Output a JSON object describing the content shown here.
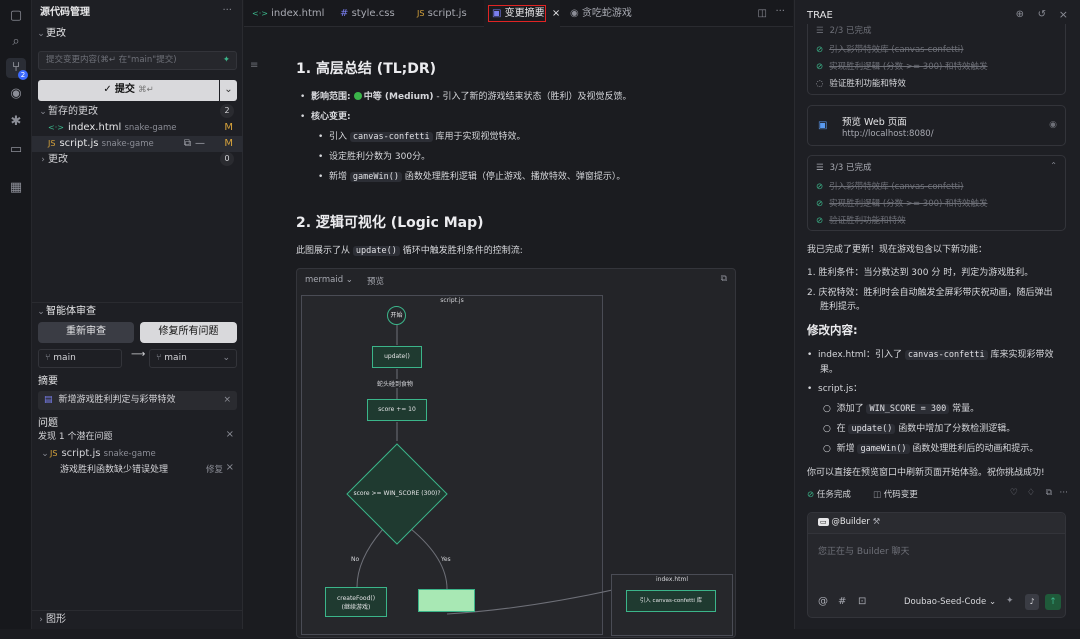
{
  "activity": {
    "scm_badge": "2"
  },
  "scm": {
    "title": "源代码管理",
    "more": "···",
    "changes_section": "更改",
    "commit_placeholder": "提交变更内容(⌘↵ 在\"main\"提交)",
    "commit_label": "提交",
    "commit_shortcut": "⌘↵",
    "staged_label": "暂存的更改",
    "staged_count": "2",
    "staged_files": [
      {
        "icon": "<·>",
        "name": "index.html",
        "folder": "snake-game",
        "status": "M"
      },
      {
        "icon": "JS",
        "name": "script.js",
        "folder": "snake-game",
        "status": "M"
      }
    ],
    "changes_label": "更改",
    "changes_count": "0",
    "agent_review_title": "智能体审查",
    "rereview_label": "重新审查",
    "fix_all_label": "修复所有问题",
    "branch_from": "main",
    "branch_to": "main",
    "summary_label": "摘要",
    "summary_text": "新增游戏胜利判定与彩带特效",
    "issues_label": "问题",
    "issues_found": "发现 1 个潜在问题",
    "issue_file": "script.js",
    "issue_folder": "snake-game",
    "issue_text": "游戏胜利函数缺少错误处理",
    "issue_fix": "修复",
    "graph_label": "图形"
  },
  "tabs": [
    {
      "icon": "<·>",
      "label": "index.html"
    },
    {
      "icon": "#",
      "label": "style.css"
    },
    {
      "icon": "JS",
      "label": "script.js"
    },
    {
      "icon": "▣",
      "label": "变更摘要"
    },
    {
      "icon": "◉",
      "label": "贪吃蛇游戏"
    }
  ],
  "doc": {
    "h1": "1. 高层总结 (TL;DR)",
    "impact_prefix": "影响范围: ",
    "impact_level": "中等 (Medium)",
    "impact_rest": " - 引入了新的游戏结束状态（胜利）及视觉反馈。",
    "core_label": "核心变更:",
    "sub1_a": "引入 ",
    "sub1_code": "canvas-confetti",
    "sub1_b": " 库用于实现视觉特效。",
    "sub2": "设定胜利分数为 300分。",
    "sub3_a": "新增 ",
    "sub3_code": "gameWin()",
    "sub3_b": " 函数处理胜利逻辑（停止游戏、播放特效、弹窗提示）。",
    "h2": "2. 逻辑可视化 (Logic Map)",
    "intro_a": "此图展示了从 ",
    "intro_code": "update()",
    "intro_b": " 循环中触发胜利条件的控制流:",
    "mermaid_label": "mermaid",
    "preview_label": "预览",
    "sub_script": "script.js",
    "sub_index": "index.html",
    "n_start": "开始",
    "n_update": "update()",
    "n_collide": "蛇头碰到食物",
    "n_score": "score += 10",
    "n_cond": "score >= WIN_SCORE (300)?",
    "n_no": "No",
    "n_yes": "Yes",
    "n_create1": "createFood()",
    "n_create2": "(继续游戏)",
    "n_confetti": "引入 canvas-confetti 库"
  },
  "trae": {
    "title": "TRAE",
    "top_task_header": "2/3 已完成",
    "top_tasks": [
      {
        "label": "引入彩带特效库 (canvas-confetti)",
        "done": true
      },
      {
        "label": "实现胜利逻辑 (分数 >= 300) 和特效触发",
        "done": true
      },
      {
        "label": "验证胜利功能和特效",
        "done": false
      }
    ],
    "preview_title": "预览 Web 页面",
    "preview_url": "http://localhost:8080/",
    "task_header": "3/3 已完成",
    "tasks": [
      {
        "label": "引入彩带特效库 (canvas-confetti)"
      },
      {
        "label": "实现胜利逻辑 (分数 >= 300) 和特效触发"
      },
      {
        "label": "验证胜利功能和特效"
      }
    ],
    "msg_intro": "我已完成了更新！现在游戏包含以下新功能：",
    "msg_p1": "1. 胜利条件：当分数达到 300 分 时，判定为游戏胜利。",
    "msg_p2a": "2. 庆祝特效：胜利时会自动触发全屏彩带庆祝动画，随后弹出",
    "msg_p2b": "胜利提示。",
    "mod_title": "修改内容:",
    "mod_index_a": "index.html：引入了 ",
    "mod_index_code": "canvas-confetti",
    "mod_index_b": " 库来实现彩带效",
    "mod_index_c": "果。",
    "mod_script": "script.js：",
    "mod_s1_a": "添加了 ",
    "mod_s1_code": "WIN_SCORE = 300",
    "mod_s1_b": " 常量。",
    "mod_s2_a": "在 ",
    "mod_s2_code": "update()",
    "mod_s2_b": " 函数中增加了分数检测逻辑。",
    "mod_s3_a": "新增 ",
    "mod_s3_code": "gameWin()",
    "mod_s3_b": " 函数处理胜利后的动画和提示。",
    "msg_end": "你可以直接在预览窗口中刷新页面开始体验。祝你挑战成功!",
    "task_done": "任务完成",
    "code_changes": "代码变更",
    "builder_tag": "@Builder",
    "chat_placeholder": "您正在与 Builder 聊天",
    "model": "Doubao-Seed-Code"
  }
}
